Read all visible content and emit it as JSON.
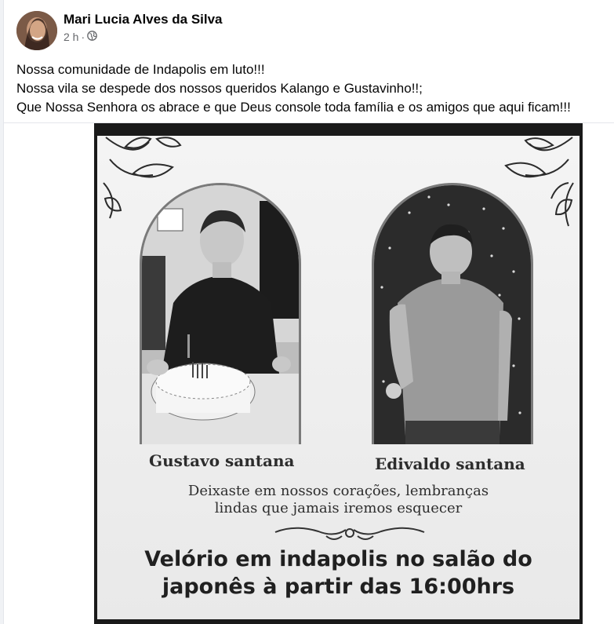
{
  "post": {
    "author": "Mari Lucia Alves da Silva",
    "time": "2 h",
    "separator": "·",
    "audience_icon": "globe-icon",
    "caption_lines": [
      "Nossa comunidade de Indapolis em luto!!!",
      "Nossa vila se despede dos nossos queridos Kalango e Gustavinho!!;",
      "Que Nossa Senhora os abrace e que Deus console toda família e os amigos que aqui ficam!!!"
    ]
  },
  "memorial": {
    "person_left": "Gustavo santana",
    "person_right": "Edivaldo santana",
    "message_lines": [
      "Deixaste em nossos corações, lembranças",
      "lindas que jamais iremos esquecer"
    ],
    "funeral_lines": [
      "Velório em indapolis no salão do",
      "japonês à partir das 16:00hrs"
    ]
  }
}
